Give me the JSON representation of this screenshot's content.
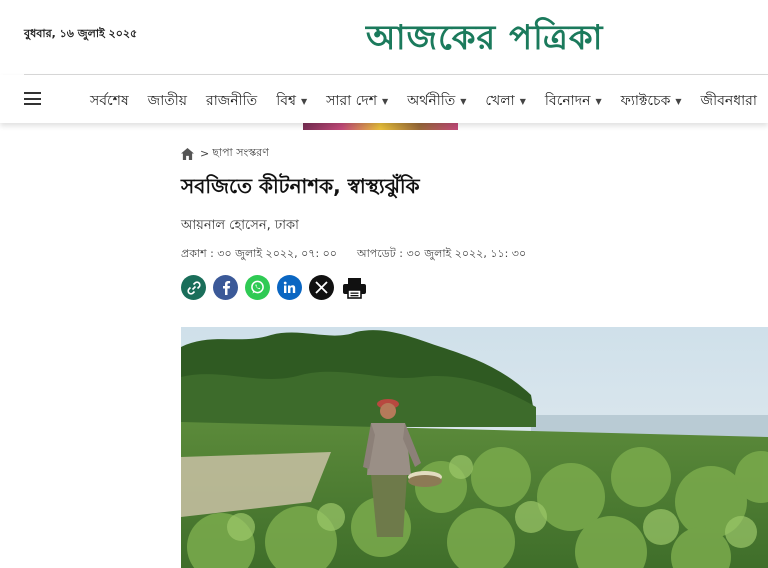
{
  "header": {
    "date": "বুধবার, ১৬ জুলাই ২০২৫",
    "logo_text": "আজকের পত্রিকা"
  },
  "nav": {
    "menu_icon": "hamburger-menu-icon",
    "items": [
      {
        "label": "সর্বশেষ",
        "has_dropdown": false
      },
      {
        "label": "জাতীয়",
        "has_dropdown": false
      },
      {
        "label": "রাজনীতি",
        "has_dropdown": false
      },
      {
        "label": "বিশ্ব",
        "has_dropdown": true
      },
      {
        "label": "সারা দেশ",
        "has_dropdown": true
      },
      {
        "label": "অর্থনীতি",
        "has_dropdown": true
      },
      {
        "label": "খেলা",
        "has_dropdown": true
      },
      {
        "label": "বিনোদন",
        "has_dropdown": true
      },
      {
        "label": "ফ্যাক্টচেক",
        "has_dropdown": true
      },
      {
        "label": "জীবনধারা",
        "has_dropdown": false
      }
    ]
  },
  "breadcrumb": {
    "home_icon": "home-icon",
    "separator": ">",
    "section": "ছাপা সংস্করণ"
  },
  "article": {
    "title": "সবজিতে কীটনাশক, স্বাস্থ্যঝুঁকি",
    "author": "আয়নাল হোসেন, ঢাকা",
    "published": "প্রকাশ : ৩০ জুলাই ২০২২, ০৭: ০০",
    "updated": "আপডেট : ৩০ জুলাই ২০২২, ১১: ৩০"
  },
  "share": {
    "buttons": [
      "copy-link-icon",
      "facebook-icon",
      "whatsapp-icon",
      "linkedin-icon",
      "x-icon",
      "print-icon"
    ]
  },
  "colors": {
    "brand_green": "#1b7a5c",
    "link_green": "#1a6e5a",
    "facebook": "#3b5998",
    "whatsapp": "#2fca54",
    "linkedin": "#0a66c2",
    "x": "#111111"
  }
}
